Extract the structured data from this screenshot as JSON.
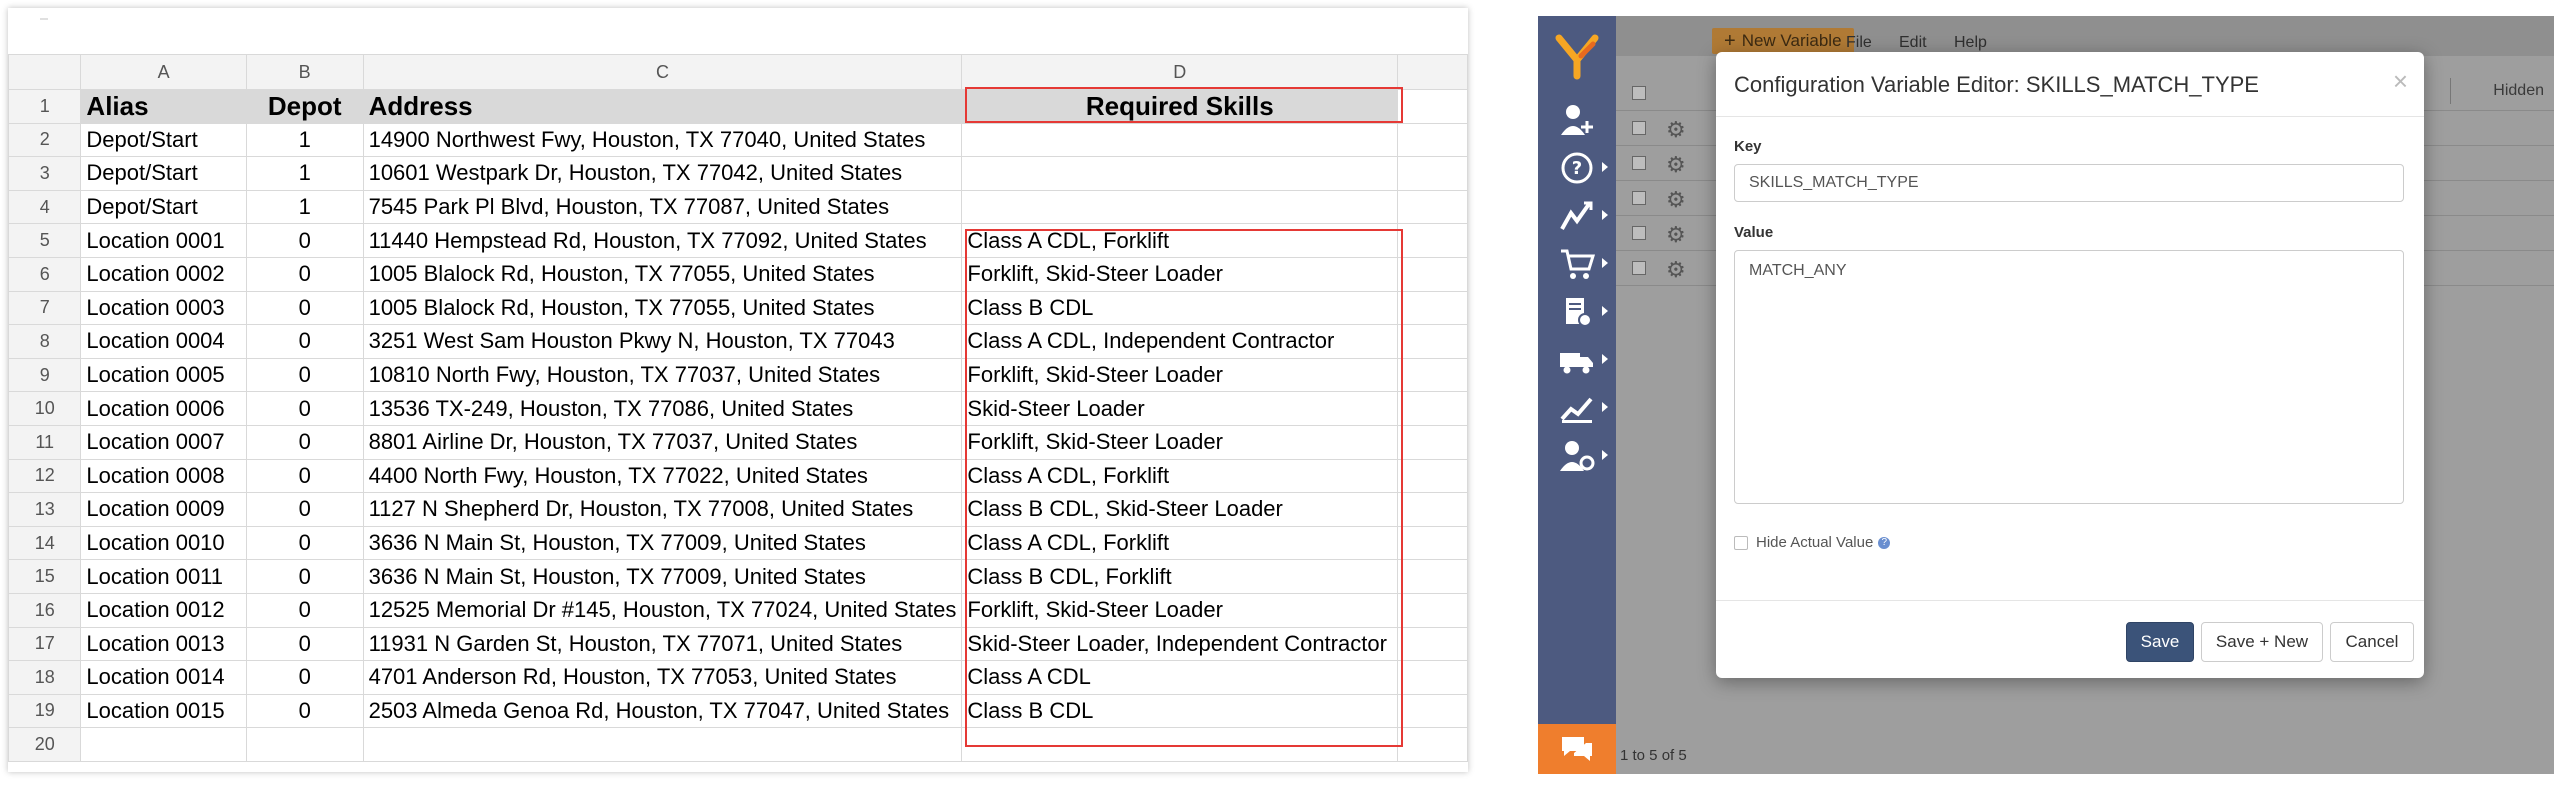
{
  "spreadsheet": {
    "columns": [
      "A",
      "B",
      "C",
      "D"
    ],
    "header": {
      "row": "1",
      "alias": "Alias",
      "depot": "Depot",
      "address": "Address",
      "skills": "Required Skills"
    },
    "rows": [
      {
        "n": "2",
        "alias": "Depot/Start",
        "depot": "1",
        "address": "14900 Northwest Fwy, Houston, TX 77040, United States",
        "skills": ""
      },
      {
        "n": "3",
        "alias": "Depot/Start",
        "depot": "1",
        "address": "10601 Westpark Dr, Houston, TX 77042, United States",
        "skills": ""
      },
      {
        "n": "4",
        "alias": "Depot/Start",
        "depot": "1",
        "address": "7545 Park Pl Blvd, Houston, TX 77087, United States",
        "skills": ""
      },
      {
        "n": "5",
        "alias": "Location 0001",
        "depot": "0",
        "address": "11440 Hempstead Rd, Houston, TX 77092, United States",
        "skills": "Class A CDL, Forklift"
      },
      {
        "n": "6",
        "alias": "Location 0002",
        "depot": "0",
        "address": "1005 Blalock Rd, Houston, TX 77055, United States",
        "skills": "Forklift, Skid-Steer Loader"
      },
      {
        "n": "7",
        "alias": "Location 0003",
        "depot": "0",
        "address": "1005 Blalock Rd, Houston, TX 77055, United States",
        "skills": "Class B CDL"
      },
      {
        "n": "8",
        "alias": "Location 0004",
        "depot": "0",
        "address": "3251 West Sam Houston Pkwy N, Houston, TX 77043",
        "skills": "Class A CDL, Independent Contractor"
      },
      {
        "n": "9",
        "alias": "Location 0005",
        "depot": "0",
        "address": "10810 North Fwy, Houston, TX 77037, United States",
        "skills": "Forklift, Skid-Steer Loader"
      },
      {
        "n": "10",
        "alias": "Location 0006",
        "depot": "0",
        "address": "13536 TX-249, Houston, TX 77086, United States",
        "skills": "Skid-Steer Loader"
      },
      {
        "n": "11",
        "alias": "Location 0007",
        "depot": "0",
        "address": "8801 Airline Dr, Houston, TX 77037, United States",
        "skills": "Forklift, Skid-Steer Loader"
      },
      {
        "n": "12",
        "alias": "Location 0008",
        "depot": "0",
        "address": "4400 North Fwy, Houston, TX 77022, United States",
        "skills": "Class A CDL, Forklift"
      },
      {
        "n": "13",
        "alias": "Location 0009",
        "depot": "0",
        "address": "1127 N Shepherd Dr, Houston, TX 77008, United States",
        "skills": "Class B CDL, Skid-Steer Loader"
      },
      {
        "n": "14",
        "alias": "Location 0010",
        "depot": "0",
        "address": "3636 N Main St, Houston, TX 77009, United States",
        "skills": "Class A CDL, Forklift"
      },
      {
        "n": "15",
        "alias": "Location 0011",
        "depot": "0",
        "address": "3636 N Main St, Houston, TX 77009, United States",
        "skills": "Class B CDL, Forklift"
      },
      {
        "n": "16",
        "alias": "Location 0012",
        "depot": "0",
        "address": "12525 Memorial Dr #145, Houston, TX 77024, United States",
        "skills": "Forklift, Skid-Steer Loader"
      },
      {
        "n": "17",
        "alias": "Location 0013",
        "depot": "0",
        "address": "11931 N Garden St, Houston, TX 77071, United States",
        "skills": "Skid-Steer Loader, Independent Contractor"
      },
      {
        "n": "18",
        "alias": "Location 0014",
        "depot": "0",
        "address": "4701 Anderson Rd, Houston, TX 77053, United States",
        "skills": "Class A CDL"
      },
      {
        "n": "19",
        "alias": "Location 0015",
        "depot": "0",
        "address": "2503 Almeda Genoa Rd, Houston, TX 77047, United States",
        "skills": "Class B CDL"
      },
      {
        "n": "20",
        "alias": "",
        "depot": "",
        "address": "",
        "skills": ""
      }
    ],
    "highlight_color": "#e53935"
  },
  "app": {
    "toolbar": {
      "new_variable": "New Variable",
      "new_icon": "plus-icon",
      "menu_file": "File",
      "menu_edit": "Edit",
      "menu_help": "Help"
    },
    "sidebar_icons": [
      "add-driver-icon",
      "help-icon",
      "routes-icon",
      "cart-icon",
      "documents-icon",
      "vehicles-icon",
      "analytics-icon",
      "settings-user-icon"
    ],
    "background_table": {
      "hidden_col": "Hidden",
      "footer": "1 to 5 of 5"
    },
    "accent": "#4d5a80",
    "chat_color": "#ef7e2d"
  },
  "modal": {
    "title": "Configuration Variable Editor: SKILLS_MATCH_TYPE",
    "close": "×",
    "key_label": "Key",
    "key_value": "SKILLS_MATCH_TYPE",
    "value_label": "Value",
    "value_value": "MATCH_ANY",
    "hide_label": "Hide Actual Value",
    "help_glyph": "?",
    "save": "Save",
    "save_new": "Save + New",
    "cancel": "Cancel"
  }
}
